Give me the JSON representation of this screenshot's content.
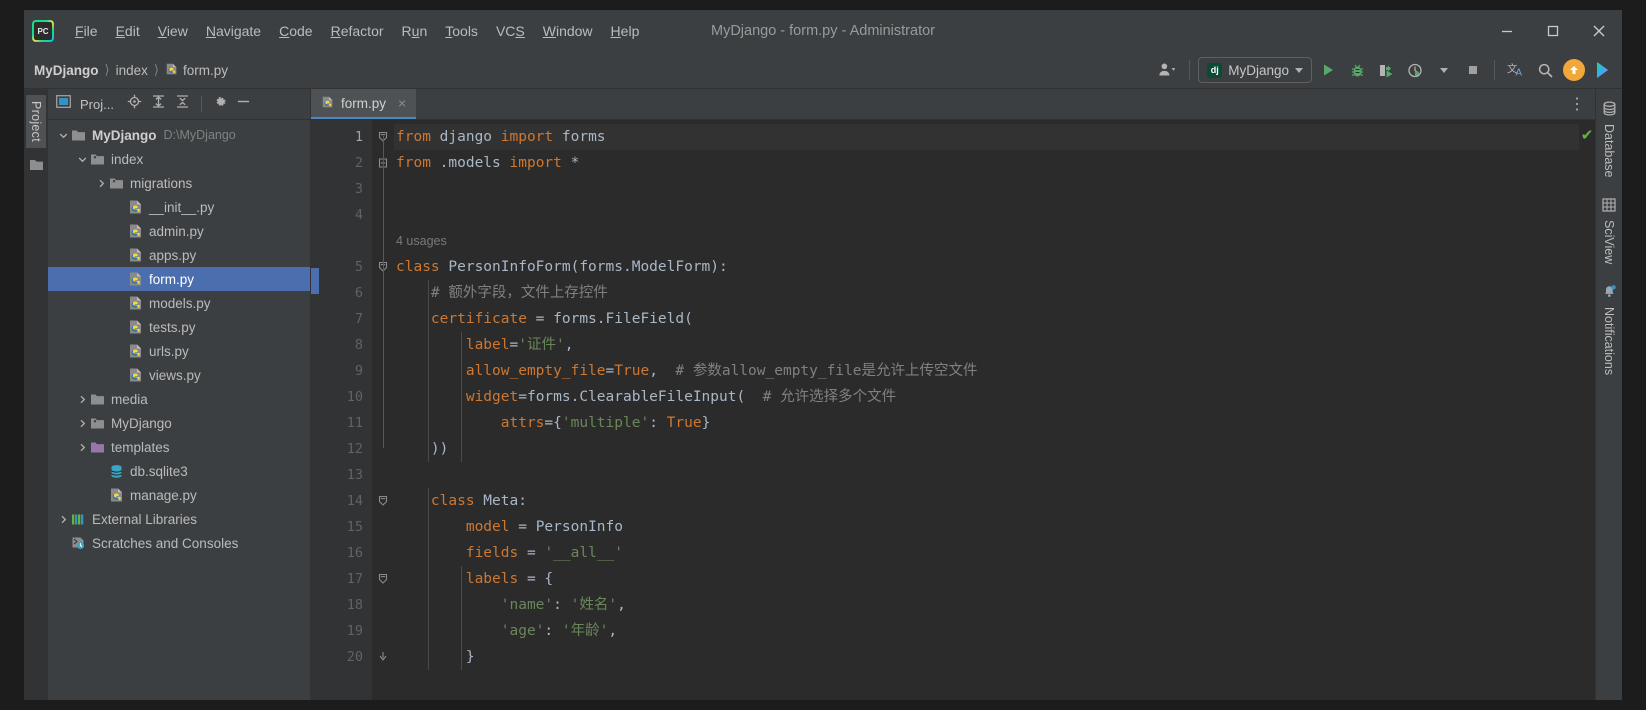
{
  "window": {
    "title": "MyDjango - form.py - Administrator",
    "minimize_label": "Minimize",
    "maximize_label": "Maximize",
    "close_label": "Close",
    "logo_text": "PC"
  },
  "menubar": {
    "items": [
      {
        "label": "File",
        "mnemonic": "F"
      },
      {
        "label": "Edit",
        "mnemonic": "E"
      },
      {
        "label": "View",
        "mnemonic": "V"
      },
      {
        "label": "Navigate",
        "mnemonic": "N"
      },
      {
        "label": "Code",
        "mnemonic": "C"
      },
      {
        "label": "Refactor",
        "mnemonic": "R"
      },
      {
        "label": "Run",
        "mnemonic": "u"
      },
      {
        "label": "Tools",
        "mnemonic": "T"
      },
      {
        "label": "VCS",
        "mnemonic": "S"
      },
      {
        "label": "Window",
        "mnemonic": "W"
      },
      {
        "label": "Help",
        "mnemonic": "H"
      }
    ]
  },
  "breadcrumb": {
    "items": [
      "MyDjango",
      "index",
      "form.py"
    ],
    "separator": "〉"
  },
  "toolbar": {
    "account_label": "Account",
    "run_config": {
      "badge": "dj",
      "name": "MyDjango"
    },
    "run_label": "Run",
    "debug_label": "Debug",
    "run_coverage_label": "Run with Coverage",
    "profile_label": "Profiler",
    "stop_label": "Stop",
    "translate_label": "Translate",
    "search_label": "Search Everywhere",
    "update_label": "Update",
    "ide_label": "IDE Assistant"
  },
  "left_strip": {
    "project_tab": "Project",
    "structure_icon": "folder-icon"
  },
  "project_panel": {
    "title": "Proj...",
    "locate_label": "Select Opened File",
    "expand_label": "Expand All",
    "collapse_label": "Collapse All",
    "settings_label": "Options",
    "hide_label": "Hide",
    "tree": [
      {
        "depth": 0,
        "arrow": "down",
        "icon": "folder-module-icon",
        "label": "MyDjango",
        "bold": true,
        "path": "D:\\MyDjango",
        "selected": false
      },
      {
        "depth": 1,
        "arrow": "down",
        "icon": "folder-source-icon",
        "label": "index",
        "bold": false,
        "path": "",
        "selected": false
      },
      {
        "depth": 2,
        "arrow": "right",
        "icon": "folder-source-icon",
        "label": "migrations",
        "bold": false,
        "path": "",
        "selected": false
      },
      {
        "depth": 3,
        "arrow": "none",
        "icon": "python-file-icon",
        "label": "__init__.py",
        "bold": false,
        "path": "",
        "selected": false
      },
      {
        "depth": 3,
        "arrow": "none",
        "icon": "python-file-icon",
        "label": "admin.py",
        "bold": false,
        "path": "",
        "selected": false
      },
      {
        "depth": 3,
        "arrow": "none",
        "icon": "python-file-icon",
        "label": "apps.py",
        "bold": false,
        "path": "",
        "selected": false
      },
      {
        "depth": 3,
        "arrow": "none",
        "icon": "python-file-icon",
        "label": "form.py",
        "bold": false,
        "path": "",
        "selected": true
      },
      {
        "depth": 3,
        "arrow": "none",
        "icon": "python-file-icon",
        "label": "models.py",
        "bold": false,
        "path": "",
        "selected": false
      },
      {
        "depth": 3,
        "arrow": "none",
        "icon": "python-file-icon",
        "label": "tests.py",
        "bold": false,
        "path": "",
        "selected": false
      },
      {
        "depth": 3,
        "arrow": "none",
        "icon": "python-file-icon",
        "label": "urls.py",
        "bold": false,
        "path": "",
        "selected": false
      },
      {
        "depth": 3,
        "arrow": "none",
        "icon": "python-file-icon",
        "label": "views.py",
        "bold": false,
        "path": "",
        "selected": false
      },
      {
        "depth": 1,
        "arrow": "right",
        "icon": "folder-icon",
        "label": "media",
        "bold": false,
        "path": "",
        "selected": false
      },
      {
        "depth": 1,
        "arrow": "right",
        "icon": "folder-source-icon",
        "label": "MyDjango",
        "bold": false,
        "path": "",
        "selected": false
      },
      {
        "depth": 1,
        "arrow": "right",
        "icon": "folder-template-icon",
        "label": "templates",
        "bold": false,
        "path": "",
        "selected": false
      },
      {
        "depth": 2,
        "arrow": "none",
        "icon": "database-icon",
        "label": "db.sqlite3",
        "bold": false,
        "path": "",
        "selected": false
      },
      {
        "depth": 2,
        "arrow": "none",
        "icon": "python-file-icon",
        "label": "manage.py",
        "bold": false,
        "path": "",
        "selected": false
      },
      {
        "depth": 0,
        "arrow": "right",
        "icon": "libraries-icon",
        "label": "External Libraries",
        "bold": false,
        "path": "",
        "selected": false
      },
      {
        "depth": 0,
        "arrow": "none",
        "icon": "scratches-icon",
        "label": "Scratches and Consoles",
        "bold": false,
        "path": "",
        "selected": false
      }
    ]
  },
  "editor": {
    "tab": {
      "label": "form.py",
      "icon": "python-file-icon",
      "close": "×"
    },
    "more_label": "⋮",
    "inspection_status": "✔",
    "line_numbers": [
      1,
      2,
      3,
      4,
      5,
      6,
      7,
      8,
      9,
      10,
      11,
      12,
      13,
      14,
      15,
      16,
      17,
      18,
      19,
      20
    ],
    "inlay_hint": "4 usages",
    "lines": [
      "from django import forms",
      "from .models import *",
      "",
      "",
      "class PersonInfoForm(forms.ModelForm):",
      "    # 额外字段，文件上存控件",
      "    certificate = forms.FileField(",
      "        label='证件',",
      "        allow_empty_file=True,  # 参数allow_empty_file是允许上传空文件",
      "        widget=forms.ClearableFileInput(  # 允许选择多个文件",
      "            attrs={'multiple': True}",
      "    ))",
      "",
      "    class Meta:",
      "        model = PersonInfo",
      "        fields = '__all__'",
      "        labels = {",
      "            'name': '姓名',",
      "            'age': '年龄',",
      "        }"
    ]
  },
  "right_strip": {
    "tabs": [
      {
        "label": "Database",
        "icon": "database-icon"
      },
      {
        "label": "SciView",
        "icon": "grid-icon"
      },
      {
        "label": "Notifications",
        "icon": "bell-icon"
      }
    ]
  },
  "colors": {
    "accent_blue": "#4b6eaf",
    "keyword_orange": "#cc7832",
    "string_green": "#6a8759",
    "comment_gray": "#808080",
    "function_yellow": "#ffc66d",
    "number_blue": "#6897bb",
    "default_text": "#a9b7c6",
    "editor_bg": "#2b2b2b",
    "panel_bg": "#3c3f41",
    "run_green": "#59a869",
    "check_green": "#62b543"
  }
}
